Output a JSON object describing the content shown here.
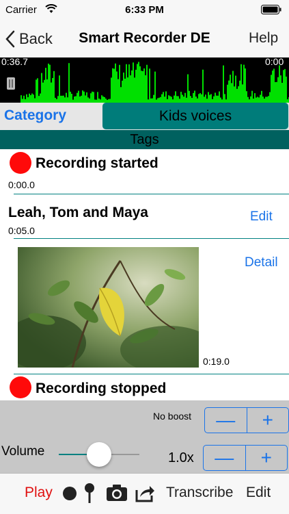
{
  "status_bar": {
    "carrier": "Carrier",
    "time": "6:33 PM"
  },
  "nav": {
    "back_label": "Back",
    "title": "Smart Recorder DE",
    "help_label": "Help"
  },
  "waveform": {
    "start_time": "0:36.7",
    "end_time": "0:00",
    "color": "#00e000"
  },
  "category": {
    "label": "Category",
    "value": "Kids voices"
  },
  "tags": {
    "label": "Tags"
  },
  "items": [
    {
      "title": "Recording started",
      "time": "0:00.0"
    },
    {
      "title": "Leah, Tom and Maya",
      "time": "0:05.0",
      "action": "Edit"
    },
    {
      "photo_time": "0:19.0",
      "action": "Detail"
    },
    {
      "title": "Recording stopped"
    }
  ],
  "controls": {
    "boost_label": "No boost",
    "volume_label": "Volume",
    "volume_level": 0.5,
    "speed_value": "1.0x",
    "minus": "—",
    "plus": "+"
  },
  "toolbar": {
    "play_label": "Play",
    "transcribe_label": "Transcribe",
    "edit_label": "Edit"
  },
  "colors": {
    "accent": "#1a73e8",
    "teal": "#007c7a",
    "record_red": "#ff0a0a",
    "play_red": "#e01010"
  }
}
